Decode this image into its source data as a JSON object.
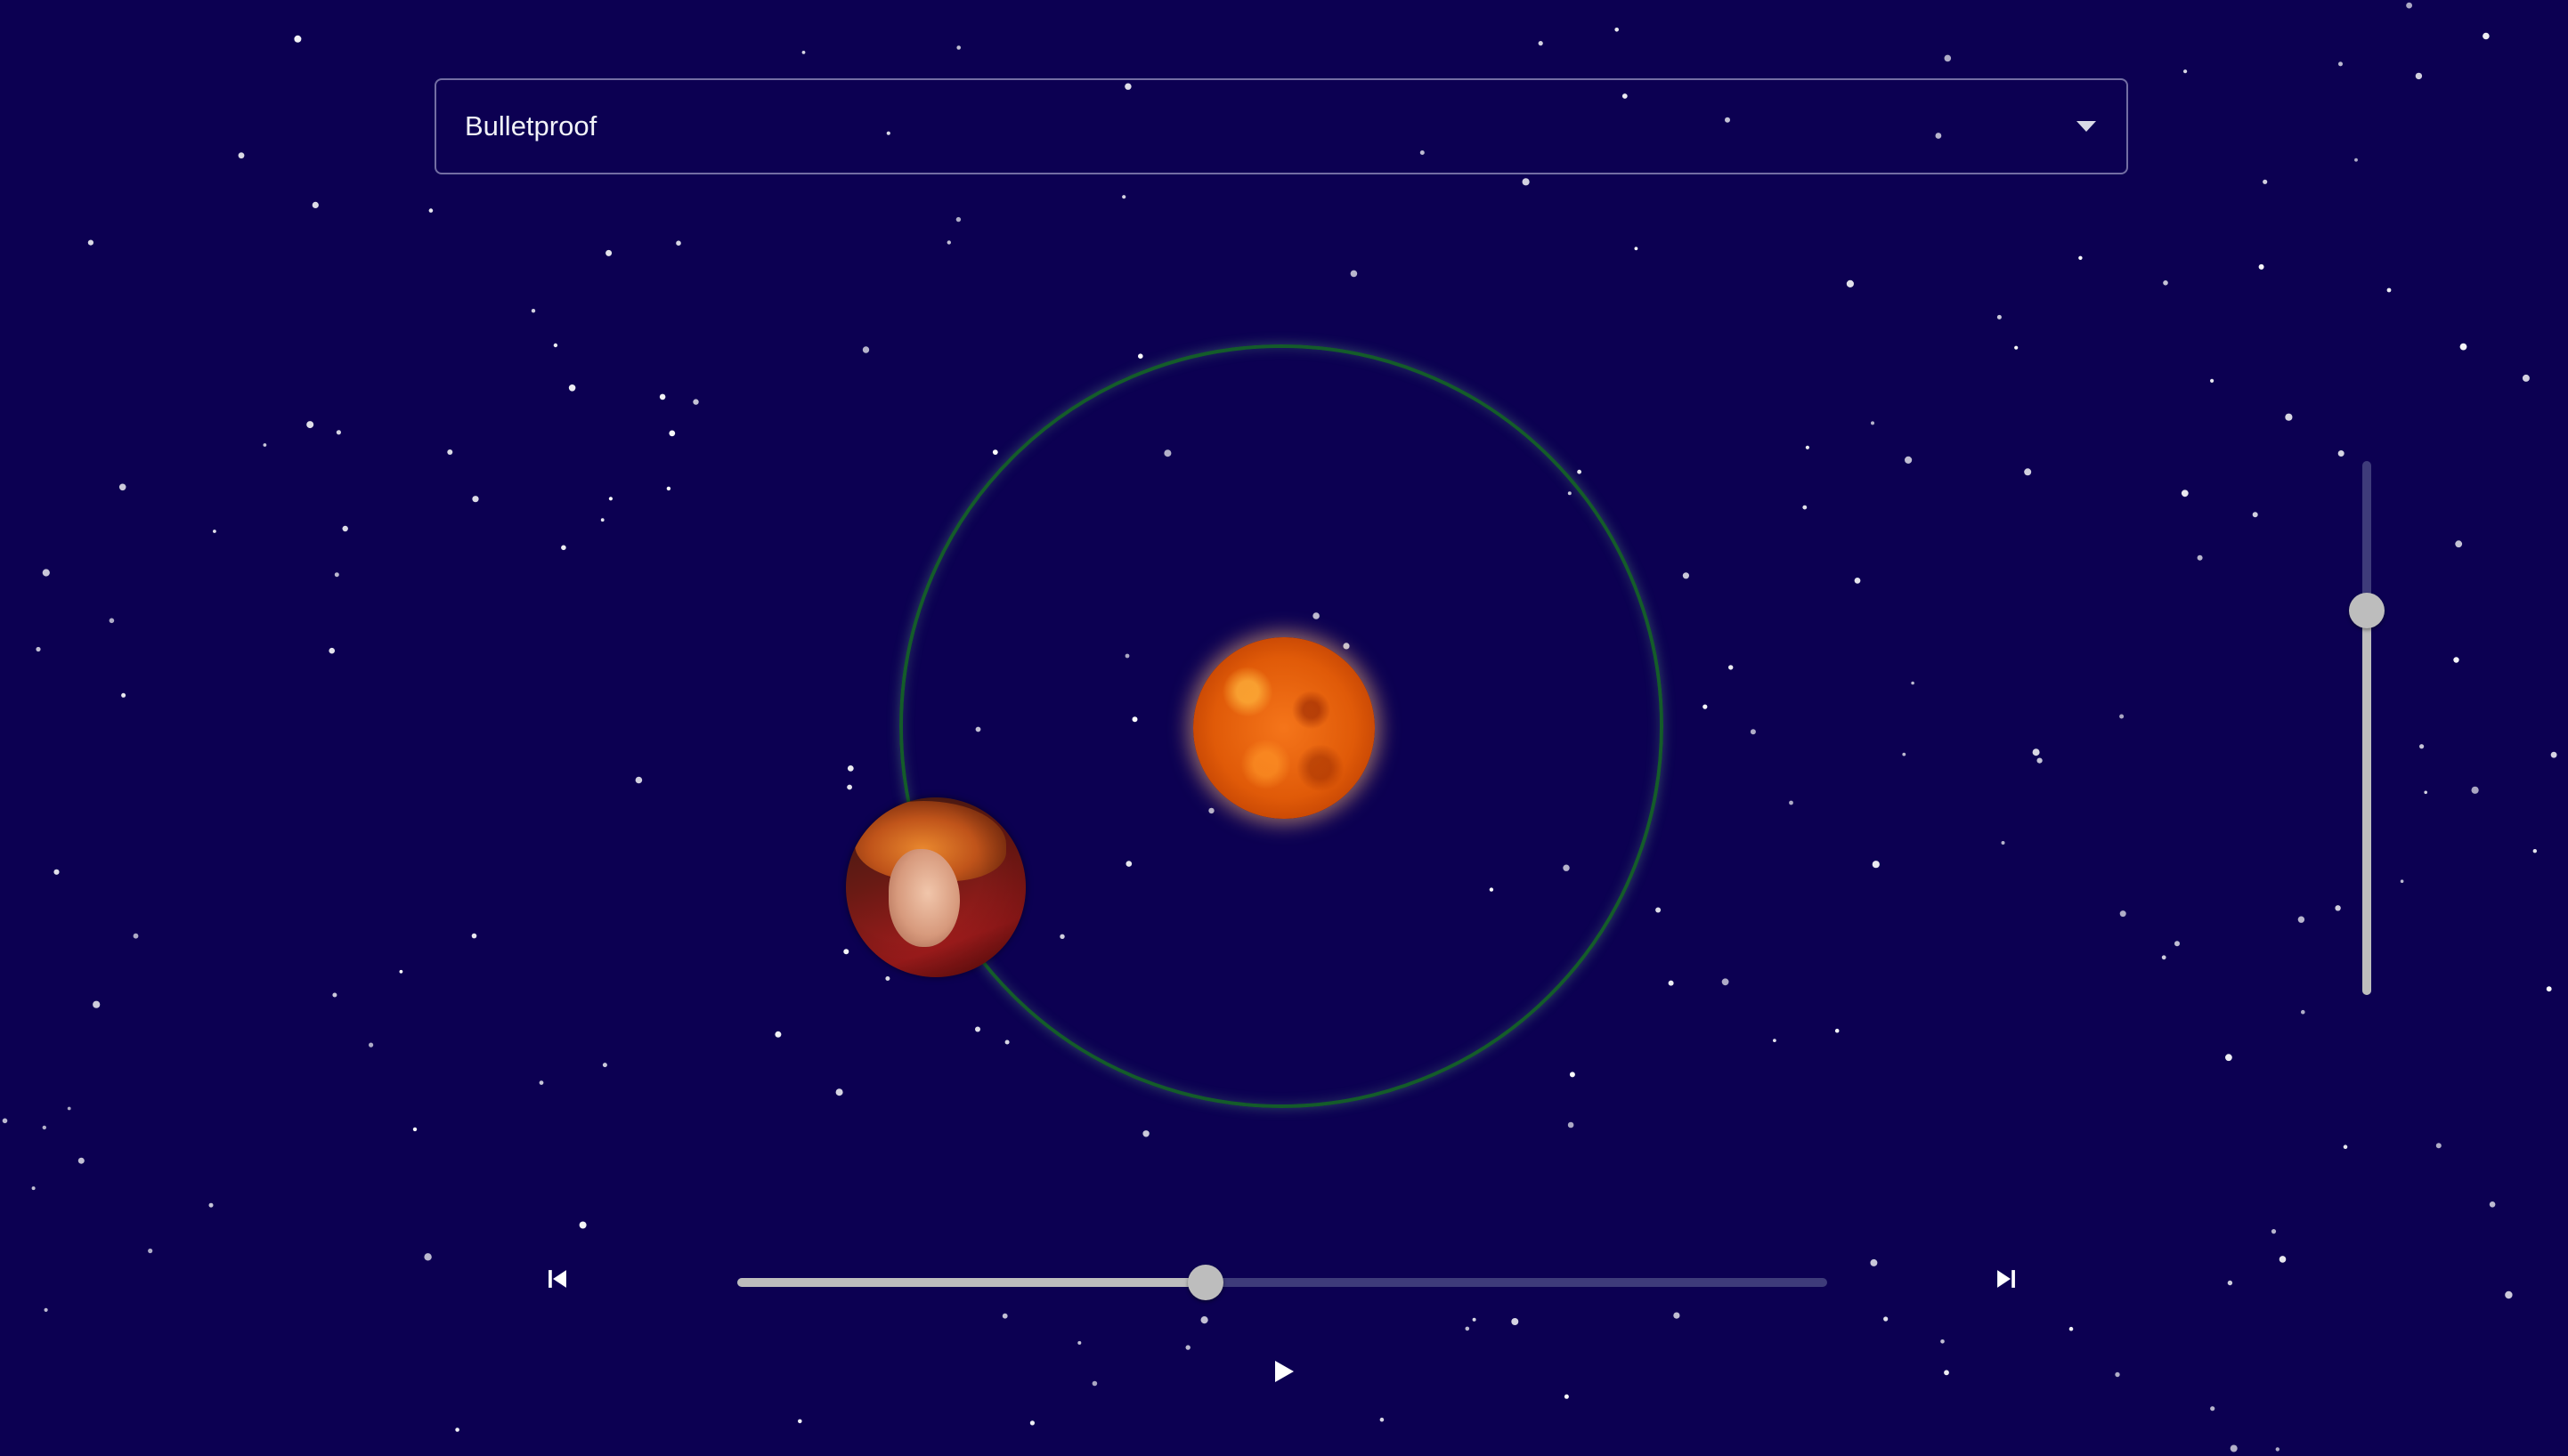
{
  "player": {
    "track_select": {
      "selected_value": "Bulletproof"
    },
    "progress_fraction": 0.43,
    "volume_fraction": 0.72,
    "controls": {
      "previous_icon": "skip-previous-icon",
      "next_icon": "skip-next-icon",
      "play_icon": "play-icon"
    }
  },
  "scene": {
    "background_color": "#0c0052",
    "orbit_color": "#145c2a",
    "sun_color": "#e05a08",
    "slider_color": "#bdbdbd",
    "slider_track_color": "#3e3b7a",
    "album_art": "album-cover-planet"
  }
}
